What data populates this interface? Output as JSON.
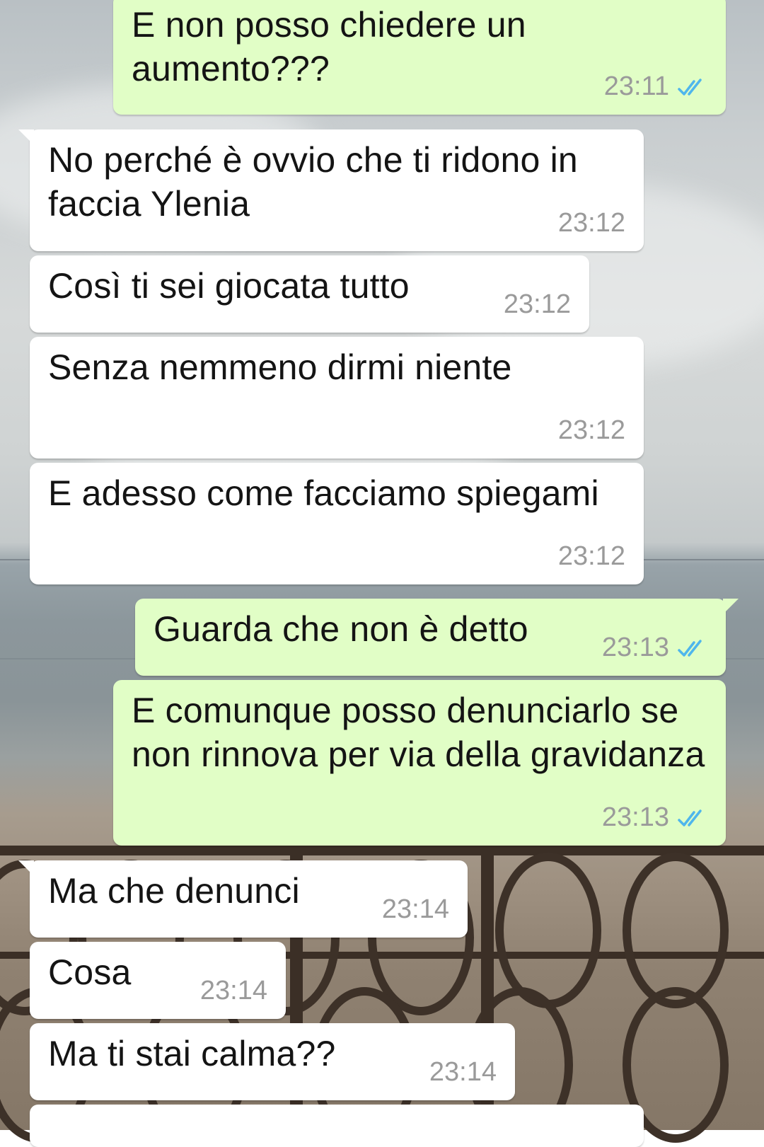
{
  "messages": [
    {
      "direction": "out",
      "text": "E non posso chiedere un aumento???",
      "time": "23:11",
      "status": "read"
    },
    {
      "direction": "in",
      "text": "No perché è ovvio che ti ridono in faccia Ylenia",
      "time": "23:12"
    },
    {
      "direction": "in",
      "text": "Così ti sei giocata tutto",
      "time": "23:12"
    },
    {
      "direction": "in",
      "text": "Senza nemmeno dirmi niente",
      "time": "23:12"
    },
    {
      "direction": "in",
      "text": "E adesso come facciamo spiegami",
      "time": "23:12"
    },
    {
      "direction": "out",
      "text": "Guarda che non è detto",
      "time": "23:13",
      "status": "read"
    },
    {
      "direction": "out",
      "text": "E comunque posso denunciarlo se non rinnova per via della gravidanza",
      "time": "23:13",
      "status": "read"
    },
    {
      "direction": "in",
      "text": "Ma che denunci",
      "time": "23:14"
    },
    {
      "direction": "in",
      "text": "Cosa",
      "time": "23:14"
    },
    {
      "direction": "in",
      "text": "Ma ti stai calma??",
      "time": "23:14"
    }
  ],
  "colors": {
    "incoming_bubble": "#ffffff",
    "outgoing_bubble": "#e1fec6",
    "read_tick": "#4fb6ec",
    "time_text": "#9a9a9a"
  },
  "icons": {
    "read_receipt": "double-check-icon"
  }
}
